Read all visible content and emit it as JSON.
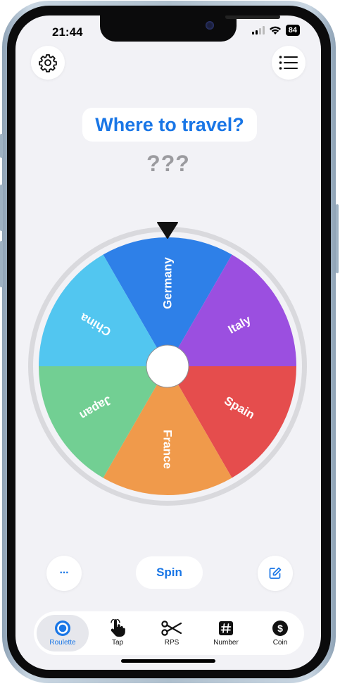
{
  "status": {
    "time": "21:44",
    "battery": "84"
  },
  "header": {
    "title": "Where to travel?"
  },
  "result": {
    "text": "???"
  },
  "wheel": {
    "segments": [
      {
        "label": "Germany",
        "color": "#2e80e8"
      },
      {
        "label": "Italy",
        "color": "#9b4fe0"
      },
      {
        "label": "Spain",
        "color": "#e54d4d"
      },
      {
        "label": "France",
        "color": "#f09a4b"
      },
      {
        "label": "Japan",
        "color": "#72cf93"
      },
      {
        "label": "China",
        "color": "#52c6f0"
      }
    ],
    "rim_color": "#d9d9dd"
  },
  "controls": {
    "spin_label": "Spin",
    "more_label": "···"
  },
  "tabs": [
    {
      "label": "Roulette",
      "icon": "roulette-icon",
      "active": true
    },
    {
      "label": "Tap",
      "icon": "tap-hand-icon",
      "active": false
    },
    {
      "label": "RPS",
      "icon": "scissors-icon",
      "active": false
    },
    {
      "label": "Number",
      "icon": "hash-icon",
      "active": false
    },
    {
      "label": "Coin",
      "icon": "coin-icon",
      "active": false
    }
  ],
  "colors": {
    "accent": "#1976e6",
    "background": "#f2f2f6"
  }
}
